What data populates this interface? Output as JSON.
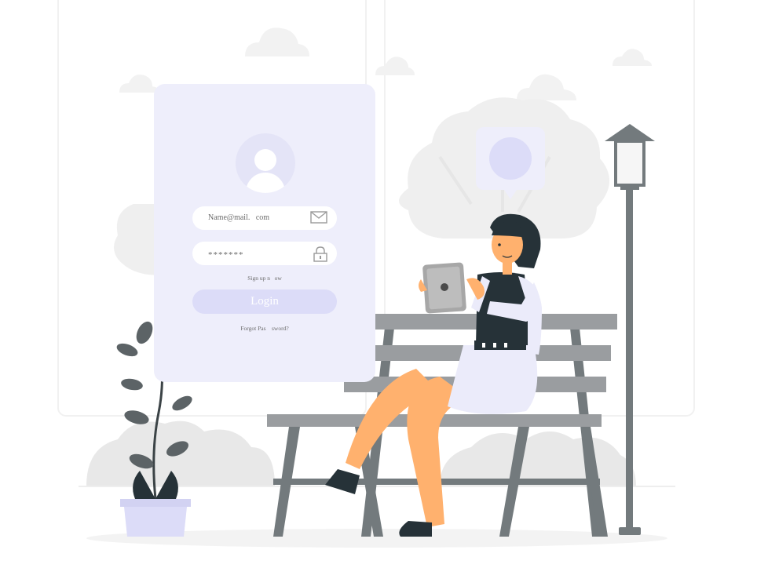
{
  "login": {
    "email_placeholder": "Name@mail.   com",
    "password_mask": "*******",
    "signup_label": "Sign up n   ow",
    "login_label": "Login",
    "forgot_label": "Forgot Pas    sword?"
  },
  "icons": {
    "email": "envelope-icon",
    "password": "lock-icon",
    "avatar": "user-avatar-icon"
  },
  "colors": {
    "card": "#eeeefb",
    "accent": "#dcdcf8",
    "skin": "#ffb16e",
    "bench": "#9a9da0",
    "dark": "#263238"
  }
}
